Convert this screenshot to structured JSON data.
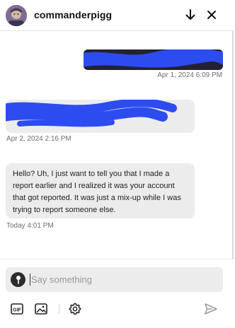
{
  "header": {
    "username": "commanderpigg",
    "avatar_icon": "avatar-image",
    "actions": [
      "arrow-down-icon",
      "close-icon"
    ]
  },
  "messages": [
    {
      "direction": "outgoing",
      "text_redacted": true,
      "timestamp": "Apr 1, 2024 6:09 PM"
    },
    {
      "direction": "incoming",
      "text_redacted": true,
      "timestamp": "Apr 2, 2024 2:16 PM"
    },
    {
      "direction": "incoming",
      "text": "Hello? Uh, I just want to tell you that I made a report earlier and I realized it was your account that got reported. It was just a mix-up while I was trying to report someone else.",
      "timestamp": "Today 4:01 PM"
    }
  ],
  "composer": {
    "placeholder": "Say something",
    "value": "",
    "tools": [
      "gif-icon",
      "image-icon",
      "gear-icon"
    ],
    "send_icon": "send-icon"
  },
  "colors": {
    "outgoing_bubble": "#222232",
    "incoming_bubble": "#ececec",
    "redaction": "#2d4cf0",
    "timestamp": "#6e6e6e"
  }
}
